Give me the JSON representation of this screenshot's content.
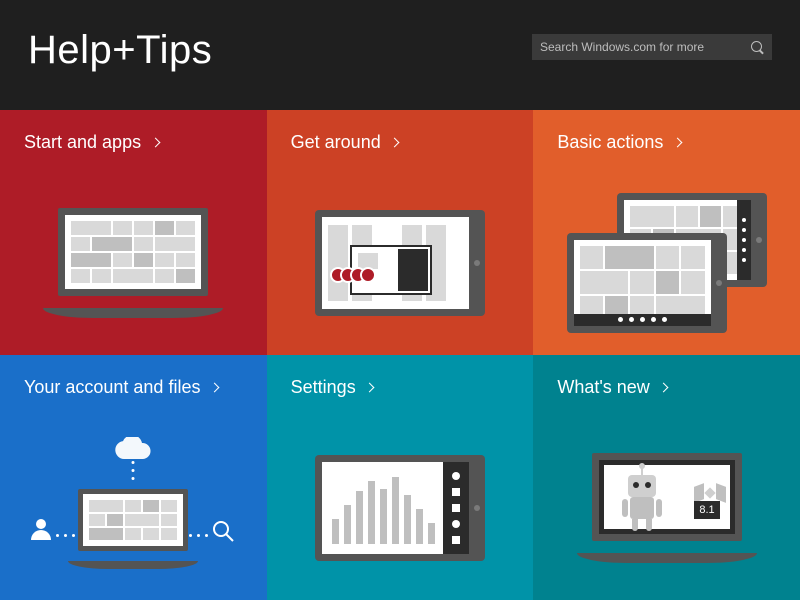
{
  "header": {
    "title": "Help+Tips",
    "search_placeholder": "Search Windows.com for more"
  },
  "tiles": [
    {
      "label": "Start and apps",
      "color": "#ae1c27"
    },
    {
      "label": "Get around",
      "color": "#cc4125"
    },
    {
      "label": "Basic actions",
      "color": "#e15e2b"
    },
    {
      "label": "Your account and files",
      "color": "#1a6fc9"
    },
    {
      "label": "Settings",
      "color": "#0093a8"
    },
    {
      "label": "What's new",
      "color": "#00828f"
    }
  ],
  "whats_new_badge": "8.1"
}
